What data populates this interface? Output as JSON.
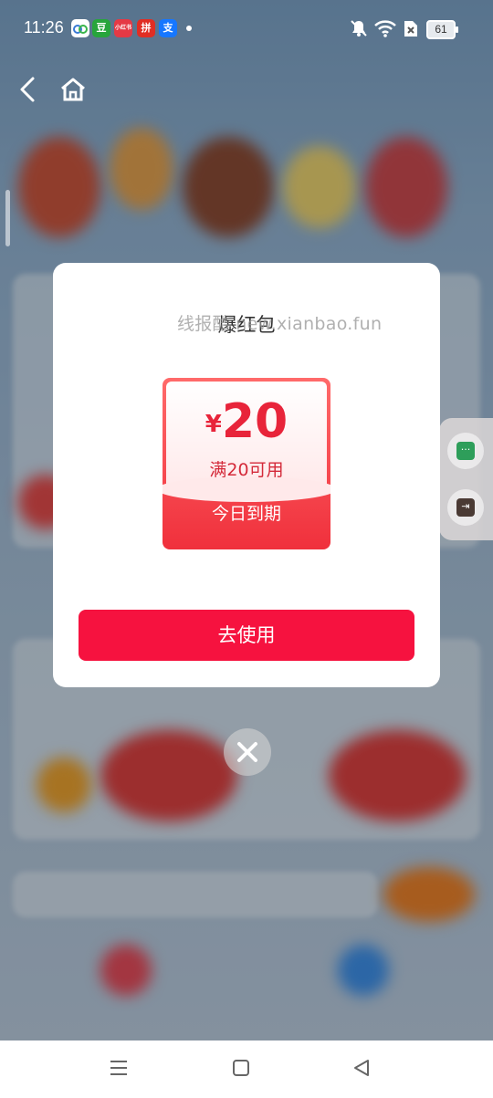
{
  "status_bar": {
    "time": "11:26",
    "battery": "61",
    "apps": [
      {
        "name": "baidu-netdisk-icon",
        "glyph": "",
        "color": "#3a7bd5"
      },
      {
        "name": "douban-icon",
        "glyph": "豆",
        "color": "#27a53c"
      },
      {
        "name": "xiaohongshu-icon",
        "glyph": "小红书",
        "color": "#e53945"
      },
      {
        "name": "pinduoduo-icon",
        "glyph": "拼",
        "color": "#e02e24"
      },
      {
        "name": "alipay-icon",
        "glyph": "支",
        "color": "#1677ff"
      }
    ]
  },
  "modal": {
    "title": "爆红包",
    "watermark": "线报酷 new.xianbao.fun",
    "coupon": {
      "currency": "¥",
      "amount": "20",
      "condition": "满20可用",
      "expiry": "今日到期"
    },
    "use_button": "去使用"
  },
  "colors": {
    "accent": "#f6123f",
    "coupon_red": "#e8243a"
  }
}
